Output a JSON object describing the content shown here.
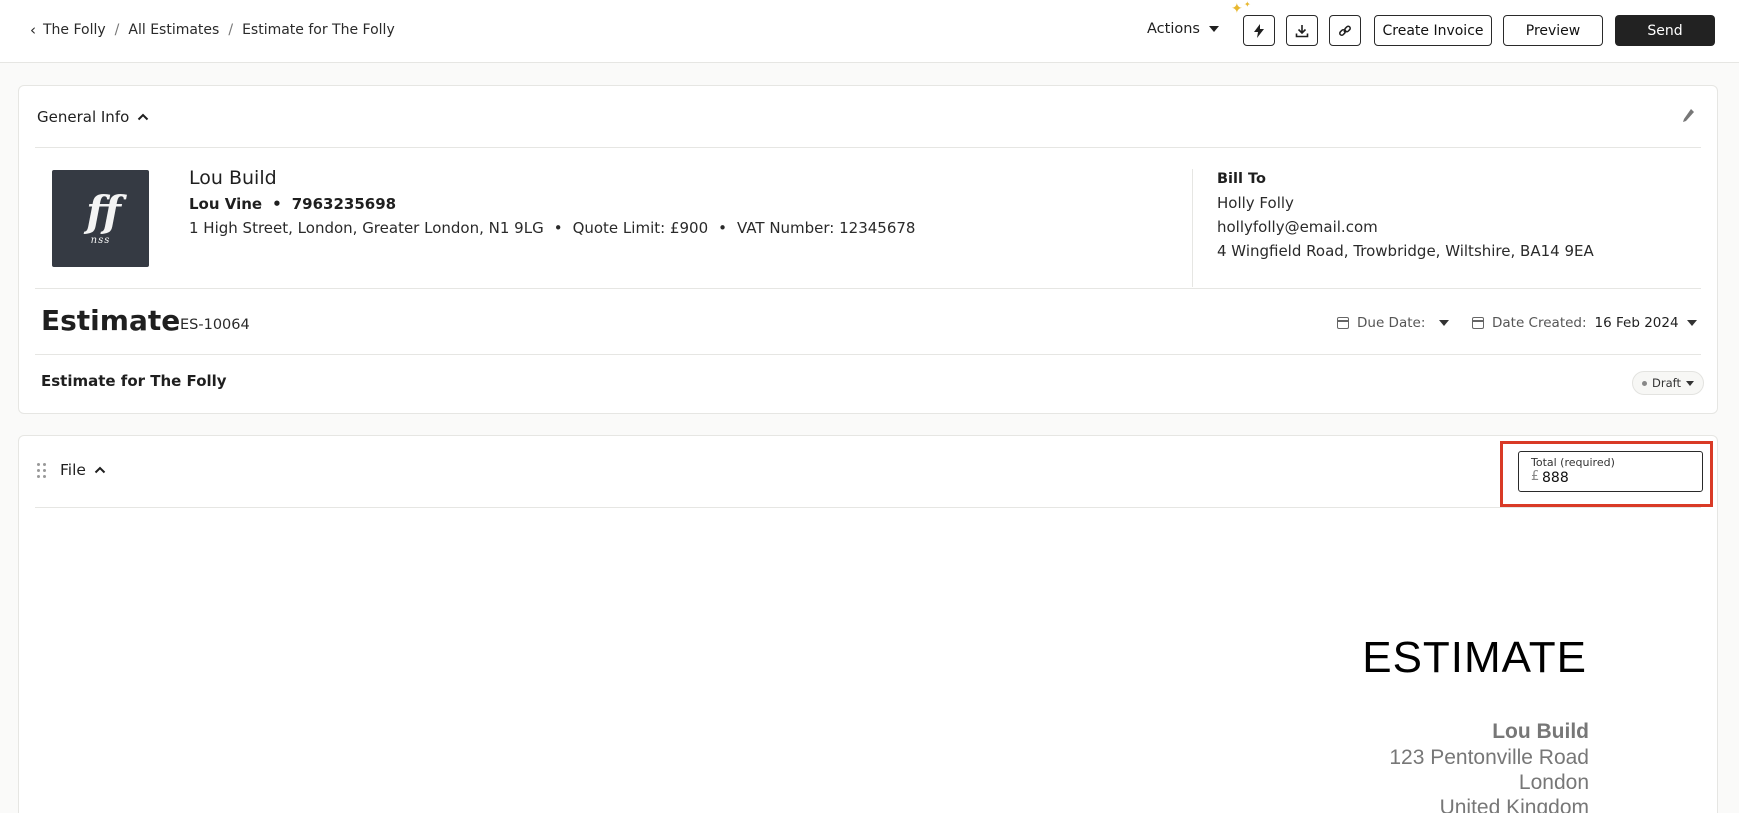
{
  "breadcrumb": {
    "back": "The Folly",
    "parent": "All Estimates",
    "current": "Estimate for The Folly",
    "separator": "/"
  },
  "toolbar": {
    "actions_label": "Actions",
    "create_invoice": "Create Invoice",
    "preview": "Preview",
    "send": "Send"
  },
  "general_info": {
    "title": "General Info",
    "company": {
      "name": "Lou Build",
      "contact_name": "Lou Vine",
      "phone": "7963235698",
      "address": "1 High Street, London, Greater London, N1 9LG",
      "quote_limit": "Quote Limit: £900",
      "vat": "VAT Number: 12345678",
      "logo_mark": "ﬀ",
      "logo_sub": "nss"
    },
    "bill_to": {
      "label": "Bill To",
      "name": "Holly Folly",
      "email": "hollyfolly@email.com",
      "address": "4 Wingfield Road, Trowbridge, Wiltshire, BA14 9EA"
    },
    "estimate": {
      "title": "Estimate",
      "number": "ES-10064",
      "due_date_label": "Due Date:",
      "date_created_label": "Date Created:",
      "date_created_value": "16 Feb 2024",
      "subject": "Estimate for The Folly",
      "status": "Draft"
    }
  },
  "file_section": {
    "title": "File",
    "total_label": "Total (required)",
    "currency": "£",
    "total_value": "888",
    "document": {
      "heading": "ESTIMATE",
      "company": "Lou Build",
      "address_line1": "123 Pentonville Road",
      "address_line2": "London",
      "address_line3": "United Kingdom"
    }
  },
  "colors": {
    "send_bg": "#222222",
    "highlight": "#d93a26",
    "logo_bg": "#353a43",
    "sparkle": "#e8b830"
  }
}
